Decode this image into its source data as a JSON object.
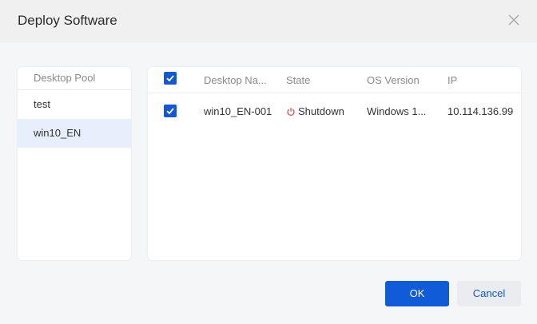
{
  "dialog": {
    "title": "Deploy Software"
  },
  "pool": {
    "header": "Desktop Pool",
    "items": [
      {
        "label": "test"
      },
      {
        "label": "win10_EN"
      }
    ]
  },
  "table": {
    "columns": {
      "desktop_name": "Desktop Na...",
      "state": "State",
      "os_version": "OS Version",
      "ip": "IP"
    },
    "rows": [
      {
        "desktop_name": "win10_EN-001",
        "state": "Shutdown",
        "os_version": "Windows 1...",
        "ip": "10.114.136.99",
        "checked": true
      }
    ],
    "select_all_checked": true
  },
  "footer": {
    "ok_label": "OK",
    "cancel_label": "Cancel"
  },
  "colors": {
    "accent": "#0f5bd8",
    "state_shutdown": "#e5484d",
    "selected_bg": "#e7effc"
  },
  "icons": {
    "close": "close-icon",
    "check": "check-icon",
    "state": "power-icon"
  }
}
